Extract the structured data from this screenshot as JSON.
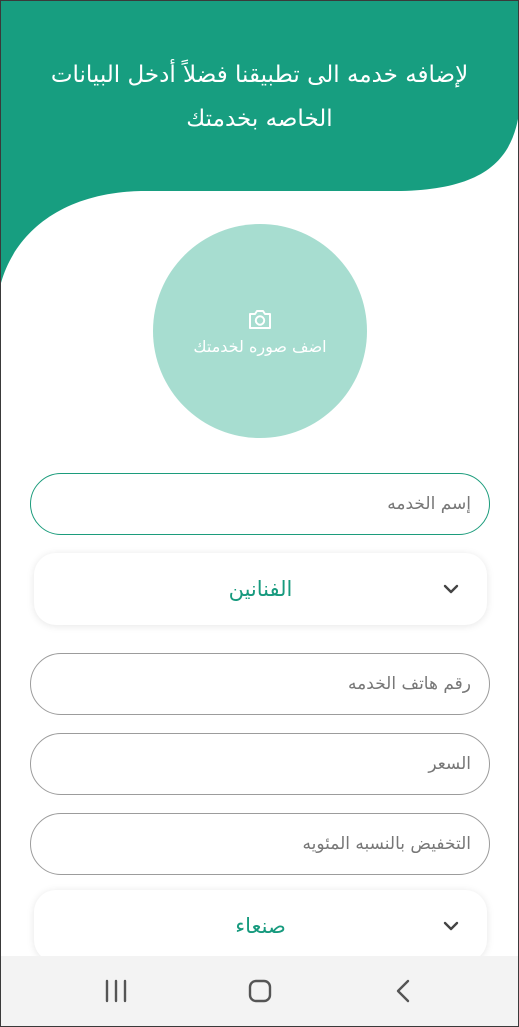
{
  "header": {
    "line1": "لإضافه خدمه الى تطبيقنا فضلاً أدخل البيانات",
    "line2": "الخاصه بخدمتك"
  },
  "photo": {
    "label": "اضف صوره لخدمتك",
    "icon": "camera-icon"
  },
  "form": {
    "service_name_placeholder": "إسم الخدمه",
    "category_dropdown_value": "الفنانين",
    "phone_placeholder": "رقم هاتف الخدمه",
    "price_placeholder": "السعر",
    "discount_placeholder": "التخفيض بالنسبه المئويه",
    "type_dropdown_value": "صنعاء"
  },
  "navbar": {
    "icons": [
      "recent-apps-icon",
      "home-icon",
      "back-icon"
    ]
  },
  "colors": {
    "primary": "#179e80",
    "photo_circle": "#a7ddd0",
    "active_border": "#1c9c7c",
    "input_border": "#9c9c9c",
    "navbar_bg": "#f3f3f3"
  }
}
